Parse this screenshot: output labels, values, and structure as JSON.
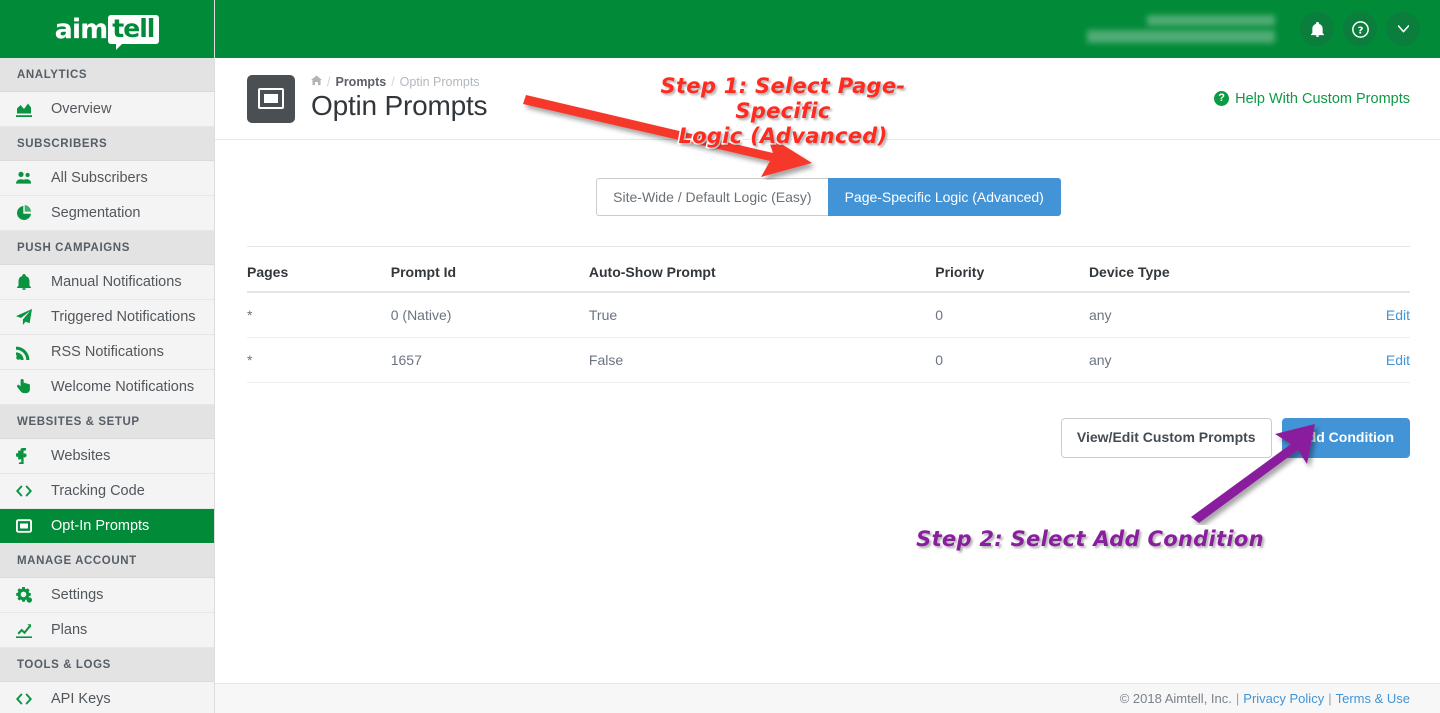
{
  "brand": {
    "logo_first": "aim",
    "logo_second": "tell",
    "green": "#018b38",
    "blue": "#4294d6"
  },
  "sidebar": {
    "groups": [
      {
        "section": "ANALYTICS",
        "items": [
          {
            "label": "Overview",
            "icon": "area-chart-icon",
            "active": false
          }
        ]
      },
      {
        "section": "SUBSCRIBERS",
        "items": [
          {
            "label": "All Subscribers",
            "icon": "users-icon",
            "active": false
          },
          {
            "label": "Segmentation",
            "icon": "pie-chart-icon",
            "active": false
          }
        ]
      },
      {
        "section": "PUSH CAMPAIGNS",
        "items": [
          {
            "label": "Manual Notifications",
            "icon": "bell-icon",
            "active": false
          },
          {
            "label": "Triggered Notifications",
            "icon": "paper-plane-icon",
            "active": false
          },
          {
            "label": "RSS Notifications",
            "icon": "rss-icon",
            "active": false
          },
          {
            "label": "Welcome Notifications",
            "icon": "hand-pointer-icon",
            "active": false
          }
        ]
      },
      {
        "section": "WEBSITES & SETUP",
        "items": [
          {
            "label": "Websites",
            "icon": "puzzle-piece-icon",
            "active": false
          },
          {
            "label": "Tracking Code",
            "icon": "code-icon",
            "active": false
          },
          {
            "label": "Opt-In Prompts",
            "icon": "window-icon",
            "active": true
          }
        ]
      },
      {
        "section": "MANAGE ACCOUNT",
        "items": [
          {
            "label": "Settings",
            "icon": "gears-icon",
            "active": false
          },
          {
            "label": "Plans",
            "icon": "line-chart-icon",
            "active": false
          }
        ]
      },
      {
        "section": "TOOLS & LOGS",
        "items": [
          {
            "label": "API Keys",
            "icon": "code-icon",
            "active": false
          }
        ]
      }
    ]
  },
  "topbar": {
    "account_line_1": "",
    "account_line_2": "",
    "icons": [
      "bell-icon",
      "question-circle-icon",
      "caret-down-icon"
    ]
  },
  "page": {
    "icon": "window-icon",
    "breadcrumb": {
      "home_icon": "home-icon",
      "sep": "/",
      "parent": "Prompts",
      "current": "Optin Prompts"
    },
    "title": "Optin Prompts",
    "help_link": "Help With Custom Prompts",
    "help_icon": "question-circle-icon"
  },
  "toggle": {
    "options": [
      {
        "label": "Site-Wide / Default Logic (Easy)",
        "selected": false
      },
      {
        "label": "Page-Specific Logic (Advanced)",
        "selected": true
      }
    ]
  },
  "table": {
    "headers": [
      "Pages",
      "Prompt Id",
      "Auto-Show Prompt",
      "Priority",
      "Device Type",
      ""
    ],
    "rows": [
      {
        "pages": "*",
        "prompt_id": "0 (Native)",
        "auto_show": "True",
        "priority": "0",
        "device_type": "any",
        "edit": "Edit"
      },
      {
        "pages": "*",
        "prompt_id": "1657",
        "auto_show": "False",
        "priority": "0",
        "device_type": "any",
        "edit": "Edit"
      }
    ]
  },
  "actions": {
    "view_edit": "View/Edit Custom Prompts",
    "add_condition": "Add Condition"
  },
  "annotations": [
    {
      "id": "step-1",
      "text": "Step 1: Select Page-Specific\nLogic (Advanced)",
      "color": "#ff2a20",
      "arrow": "red-arrow-down-right"
    },
    {
      "id": "step-2",
      "text": "Step 2: Select Add Condition",
      "color": "#8a1f9e",
      "arrow": "purple-arrow-up-right"
    }
  ],
  "footer": {
    "copyright": "© 2018 Aimtell, Inc.",
    "sep": "|",
    "privacy": "Privacy Policy",
    "terms": "Terms & Use"
  }
}
